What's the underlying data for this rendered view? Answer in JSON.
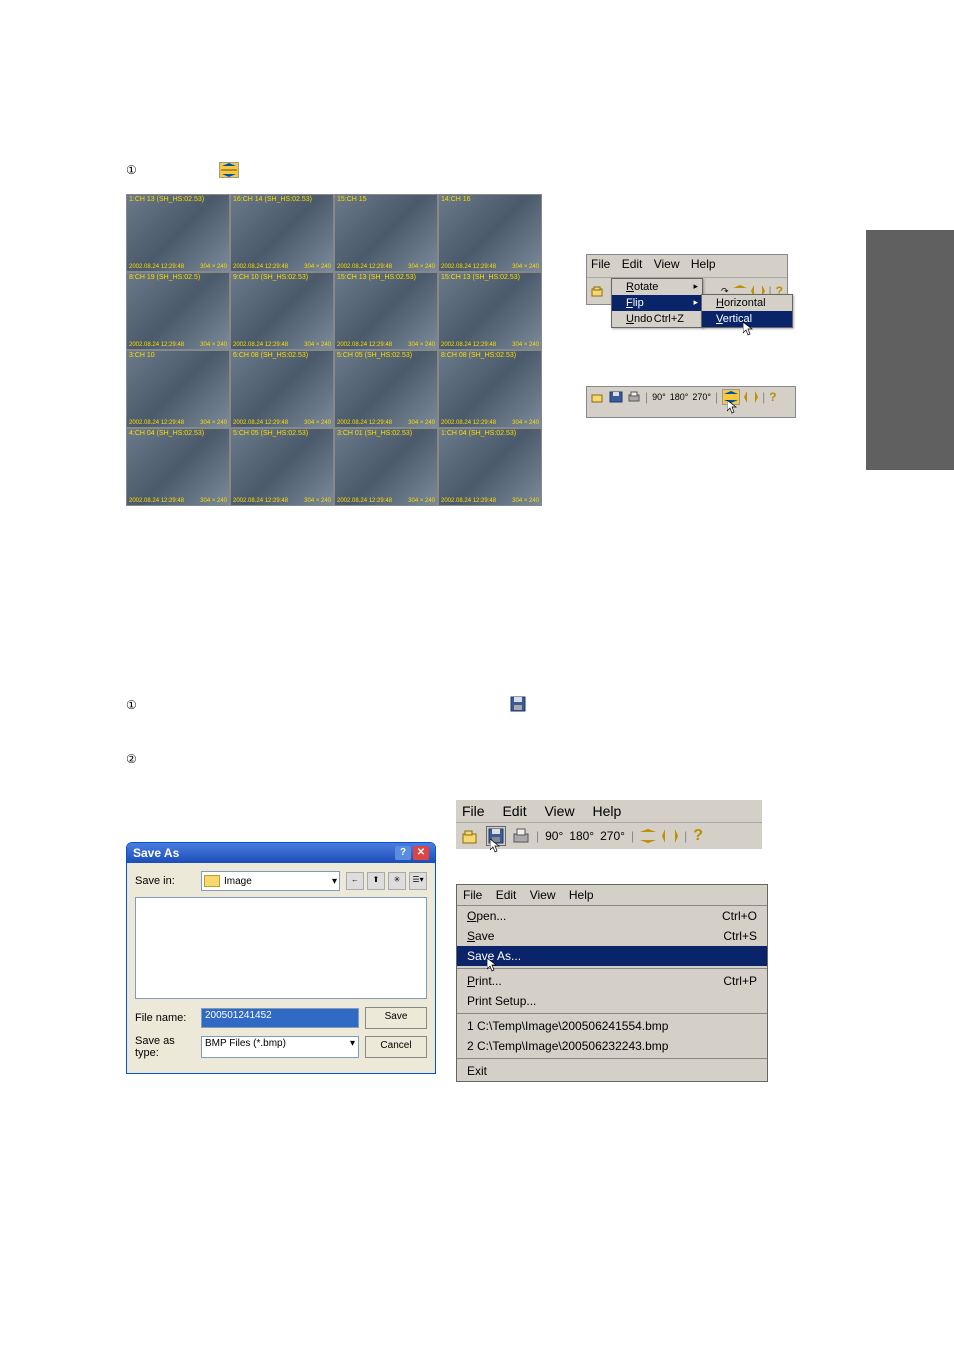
{
  "steps": {
    "step1_top": "①",
    "step1_mid": "①",
    "step2_mid": "②"
  },
  "camera_cells": [
    {
      "label": "1:CH 13 (SH_HS:02.53)",
      "ts": "2002.08.24 12:29:48",
      "res": "304 × 240"
    },
    {
      "label": "16:CH 14 (SH_HS:02.53)",
      "ts": "2002.08.24 12:29:48",
      "res": "304 × 240"
    },
    {
      "label": "15:CH 15",
      "ts": "2002.08.24 12:29:48",
      "res": "304 × 240"
    },
    {
      "label": "14:CH 16",
      "ts": "2002.08.24 12:29:48",
      "res": "304 × 240"
    },
    {
      "label": "8:CH 19 (SH_HS:02.5)",
      "ts": "2002.08.24 12:29:48",
      "res": "304 × 240"
    },
    {
      "label": "9:CH 10 (SH_HS:02.53)",
      "ts": "2002.08.24 12:29:48",
      "res": "304 × 240"
    },
    {
      "label": "15:CH 13 (SH_HS:02.53)",
      "ts": "2002.08.24 12:29:48",
      "res": "304 × 240"
    },
    {
      "label": "15:CH 13 (SH_HS:02.53)",
      "ts": "2002.08.24 12:29:48",
      "res": "304 × 240"
    },
    {
      "label": "3:CH 10",
      "ts": "2002.08.24 12:29:48",
      "res": "304 × 240"
    },
    {
      "label": "6:CH 08 (SH_HS:02.53)",
      "ts": "2002.08.24 12:29:48",
      "res": "304 × 240"
    },
    {
      "label": "5:CH 05 (SH_HS:02.53)",
      "ts": "2002.08.24 12:29:48",
      "res": "304 × 240"
    },
    {
      "label": "8:CH 08 (SH_HS:02.53)",
      "ts": "2002.08.24 12:29:48",
      "res": "304 × 240"
    },
    {
      "label": "4:CH 04 (SH_HS:02.53)",
      "ts": "2002.08.24 12:29:48",
      "res": "304 × 240"
    },
    {
      "label": "5:CH 05 (SH_HS:02.53)",
      "ts": "2002.08.24 12:29:48",
      "res": "304 × 240"
    },
    {
      "label": "3:CH 01 (SH_HS:02.53)",
      "ts": "2002.08.24 12:29:48",
      "res": "304 × 240"
    },
    {
      "label": "1:CH 04 (SH_HS:02.53)",
      "ts": "2002.08.24 12:29:48",
      "res": "304 × 240"
    }
  ],
  "menubar": {
    "file": "File",
    "edit": "Edit",
    "view": "View",
    "help": "Help"
  },
  "edit_menu": {
    "rotate": "Rotate",
    "flip": "Flip",
    "undo": "Undo",
    "undo_shortcut": "Ctrl+Z"
  },
  "flip_submenu": {
    "horizontal": "Horizontal",
    "vertical": "Vertical"
  },
  "rotation_labels": {
    "r90": "90°",
    "r180": "180°",
    "r270": "270°"
  },
  "large_toolbar": {
    "file": "File",
    "edit": "Edit",
    "view": "View",
    "help": "Help",
    "r90": "90°",
    "r180": "180°",
    "r270": "270°"
  },
  "file_menu": {
    "file": "File",
    "edit": "Edit",
    "view": "View",
    "help": "Help",
    "open": "Open...",
    "open_sc": "Ctrl+O",
    "save": "Save",
    "save_sc": "Ctrl+S",
    "saveas": "Save As...",
    "print": "Print...",
    "print_sc": "Ctrl+P",
    "print_setup": "Print Setup...",
    "recent1": "1 C:\\Temp\\Image\\200506241554.bmp",
    "recent2": "2 C:\\Temp\\Image\\200506232243.bmp",
    "exit": "Exit"
  },
  "saveas": {
    "title": "Save As",
    "save_in": "Save in:",
    "folder": "Image",
    "file_name": "File name:",
    "file_name_value": "200501241452",
    "save_as_type": "Save as type:",
    "type_value": "BMP Files (*.bmp)",
    "save_btn": "Save",
    "cancel_btn": "Cancel"
  }
}
